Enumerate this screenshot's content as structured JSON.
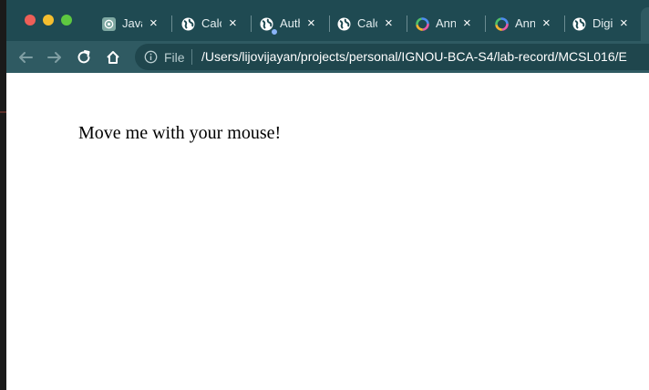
{
  "tabs": [
    {
      "title": "Java",
      "icon": "chatgpt-icon"
    },
    {
      "title": "Calc",
      "icon": "globe-icon"
    },
    {
      "title": "Auth",
      "icon": "globe-icon"
    },
    {
      "title": "Calc",
      "icon": "globe-icon"
    },
    {
      "title": "Ann",
      "icon": "colorful-ring-icon"
    },
    {
      "title": "Ann",
      "icon": "colorful-ring-icon"
    },
    {
      "title": "Digi",
      "icon": "globe-icon"
    }
  ],
  "tab_close_glyph": "×",
  "omnibox": {
    "scheme_label": "File",
    "url": "/Users/lijovijayan/projects/personal/IGNOU-BCA-S4/lab-record/MCSL016/E"
  },
  "page": {
    "text": "Move me with your mouse!"
  },
  "colors": {
    "tabbar": "#1f4a52",
    "toolbar": "#2f5a62",
    "omnibox": "#1f464d"
  }
}
